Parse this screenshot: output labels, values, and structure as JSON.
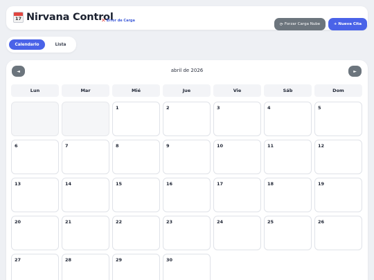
{
  "header": {
    "calendar_emoji_day": "17",
    "title": "Nirvana Control",
    "error_text": "Error de Carga",
    "sync_button": "Forzar Carga Nube",
    "new_button": "+ Nueva Cita"
  },
  "tabs": [
    {
      "label": "Calendario",
      "active": true
    },
    {
      "label": "Lista",
      "active": false
    }
  ],
  "calendar": {
    "month_label": "abril de 2026",
    "prev": "◄",
    "next": "►",
    "weekdays": [
      "Lun",
      "Mar",
      "Mié",
      "Jue",
      "Vie",
      "Sáb",
      "Dom"
    ],
    "leading_empty": 2,
    "days": [
      "1",
      "2",
      "3",
      "4",
      "5",
      "6",
      "7",
      "8",
      "9",
      "10",
      "11",
      "12",
      "13",
      "14",
      "15",
      "16",
      "17",
      "18",
      "19",
      "20",
      "21",
      "22",
      "23",
      "24",
      "25",
      "26",
      "27",
      "28",
      "29",
      "30"
    ]
  },
  "colors": {
    "accent": "#4a63e8",
    "secondary": "#6c757d",
    "error": "#e0453f",
    "background": "#eef0f4"
  }
}
